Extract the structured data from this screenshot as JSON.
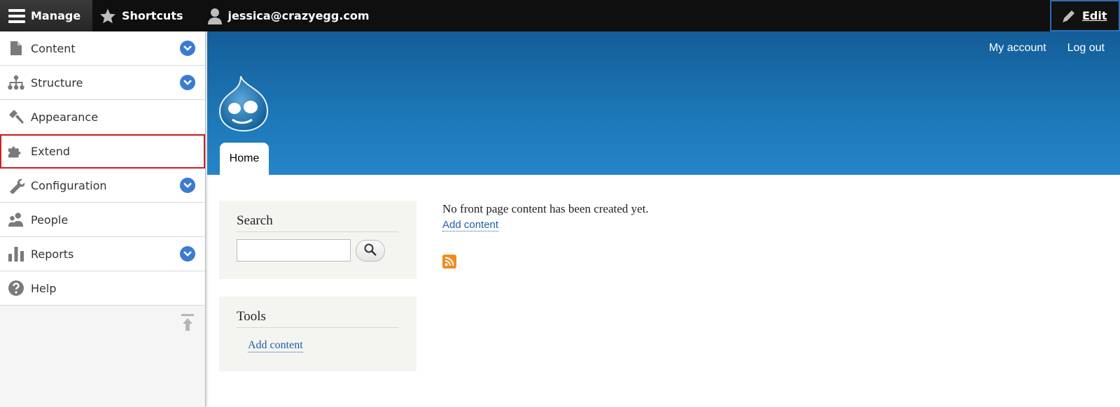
{
  "toolbar": {
    "manage_label": "Manage",
    "shortcuts_label": "Shortcuts",
    "user_label": "jessica@crazyegg.com",
    "edit_label": "Edit"
  },
  "tray": {
    "items": [
      {
        "label": "Content",
        "icon": "file-icon",
        "has_children": true
      },
      {
        "label": "Structure",
        "icon": "sitemap-icon",
        "has_children": true
      },
      {
        "label": "Appearance",
        "icon": "paintbrush-icon",
        "has_children": false
      },
      {
        "label": "Extend",
        "icon": "puzzle-icon",
        "has_children": false,
        "highlighted": true
      },
      {
        "label": "Configuration",
        "icon": "wrench-icon",
        "has_children": true
      },
      {
        "label": "People",
        "icon": "people-icon",
        "has_children": false
      },
      {
        "label": "Reports",
        "icon": "bar-chart-icon",
        "has_children": true
      },
      {
        "label": "Help",
        "icon": "help-icon",
        "has_children": false
      }
    ]
  },
  "header": {
    "secondary_menu": [
      "My account",
      "Log out"
    ],
    "tab_home": "Home"
  },
  "sidebar": {
    "search_title": "Search",
    "tools_title": "Tools",
    "tools_link": "Add content"
  },
  "main": {
    "message": "No front page content has been created yet.",
    "add_content_link": "Add content"
  },
  "colors": {
    "toolbar_bg": "#0f0f0f",
    "header_blue": "#1d78b8",
    "chevron_blue": "#3b7bd0",
    "highlight_red": "#d32020",
    "rss_orange": "#f28b1d",
    "link_blue": "#1b5fa8"
  }
}
